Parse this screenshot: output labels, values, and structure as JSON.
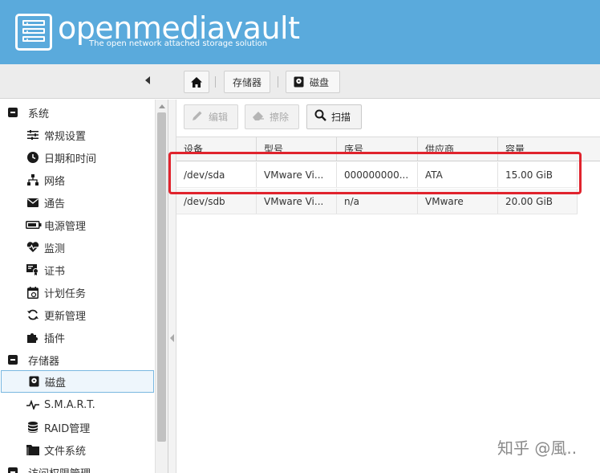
{
  "header": {
    "brand_name": "openmediavault",
    "tagline": "The open network attached storage solution",
    "background": "#5aaadc"
  },
  "breadcrumb": {
    "home_icon": "home-icon",
    "items": [
      {
        "label": "存储器"
      },
      {
        "label": "磁盘",
        "icon": "disk-icon"
      }
    ]
  },
  "sidebar": {
    "groups": [
      {
        "label": "系统",
        "items": [
          {
            "label": "常规设置",
            "icon": "sliders-icon"
          },
          {
            "label": "日期和时间",
            "icon": "clock-icon"
          },
          {
            "label": "网络",
            "icon": "network-icon"
          },
          {
            "label": "通告",
            "icon": "mail-icon"
          },
          {
            "label": "电源管理",
            "icon": "battery-icon"
          },
          {
            "label": "监测",
            "icon": "heartbeat-icon"
          },
          {
            "label": "证书",
            "icon": "certificate-icon"
          },
          {
            "label": "计划任务",
            "icon": "calendar-icon"
          },
          {
            "label": "更新管理",
            "icon": "refresh-icon"
          },
          {
            "label": "插件",
            "icon": "puzzle-icon"
          }
        ]
      },
      {
        "label": "存储器",
        "items": [
          {
            "label": "磁盘",
            "icon": "disk-icon",
            "selected": true
          },
          {
            "label": "S.M.A.R.T.",
            "icon": "pulse-icon"
          },
          {
            "label": "RAID管理",
            "icon": "database-icon"
          },
          {
            "label": "文件系统",
            "icon": "folder-icon"
          }
        ]
      },
      {
        "label": "访问权限管理",
        "items": []
      }
    ]
  },
  "toolbar": {
    "edit_label": "编辑",
    "wipe_label": "擦除",
    "scan_label": "扫描"
  },
  "grid": {
    "columns": [
      "设备",
      "型号",
      "序号",
      "供应商",
      "容量"
    ],
    "rows": [
      [
        "/dev/sda",
        "VMware Vi...",
        "000000000...",
        "ATA",
        "15.00 GiB"
      ],
      [
        "/dev/sdb",
        "VMware Vi...",
        "n/a",
        "VMware",
        "20.00 GiB"
      ]
    ]
  },
  "annotation_color": "#e0232d",
  "watermark": "知乎 @風.."
}
